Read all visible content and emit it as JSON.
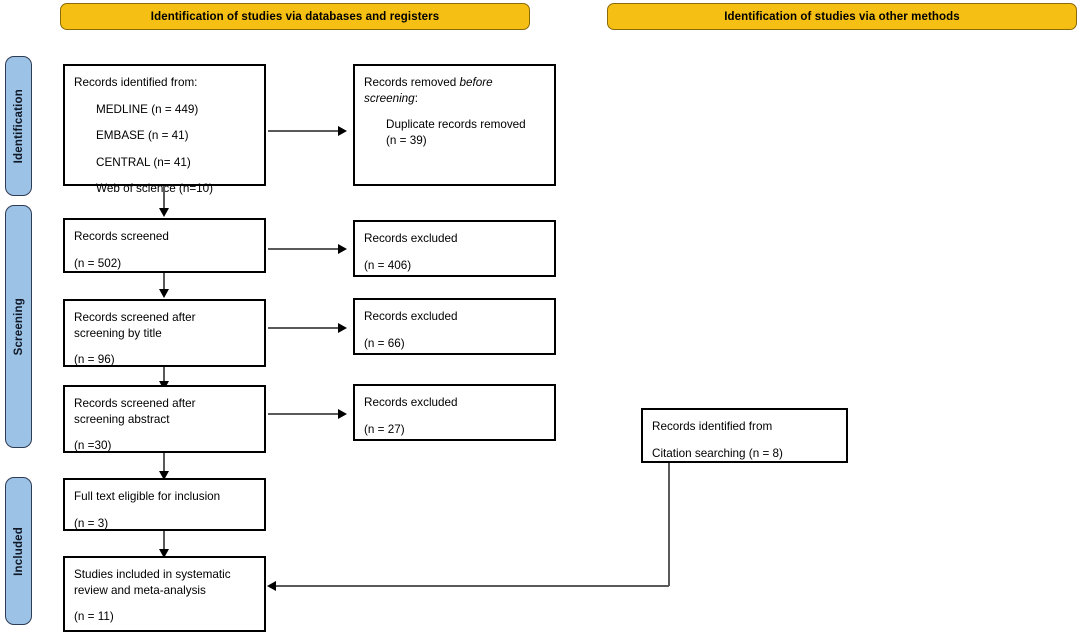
{
  "banners": [
    {
      "id": "databases-registers",
      "label": "Identification of studies via databases and registers"
    },
    {
      "id": "other-methods",
      "label": "Identification of studies via other methods"
    }
  ],
  "stages": [
    {
      "id": "identification",
      "label": "Identification"
    },
    {
      "id": "screening",
      "label": "Screening"
    },
    {
      "id": "included",
      "label": "Included"
    }
  ],
  "nodes": {
    "records_identified": {
      "title": "Records identified from:",
      "sources": [
        "MEDLINE (n = 449)",
        "EMBASE (n = 41)",
        "CENTRAL (n= 41)",
        "Web of science (n=10)"
      ]
    },
    "records_removed": {
      "line1_prefix": "Records removed ",
      "line1_italic": "before",
      "line2_italic": "screening",
      "line2_suffix": ":",
      "detail_line1": "Duplicate records removed",
      "detail_line2": "(n = 39)"
    },
    "records_screened": {
      "title": "Records screened",
      "count": "(n = 502)"
    },
    "excluded_1": {
      "title": "Records excluded",
      "count": "(n = 406)"
    },
    "screened_title": {
      "title_line1": "Records screened after",
      "title_line2": "screening by title",
      "count": "(n = 96)"
    },
    "excluded_2": {
      "title": "Records excluded",
      "count": "(n = 66)"
    },
    "screened_abstract": {
      "title_line1": "Records screened after",
      "title_line2": "screening abstract",
      "count": "(n =30)"
    },
    "excluded_3": {
      "title": "Records excluded",
      "count": "(n = 27)"
    },
    "full_text": {
      "title": "Full text eligible for inclusion",
      "count": "(n = 3)"
    },
    "studies_included": {
      "title_line1": "Studies included in systematic",
      "title_line2": "review and meta-analysis",
      "count": "(n = 11)"
    },
    "citation_searching": {
      "title": "Records identified from",
      "detail": "Citation searching (n = 8)"
    }
  },
  "colors": {
    "banner_fill": "#F5BF14",
    "banner_border": "#8A6A08",
    "stage_fill": "#9CC3E5",
    "stage_border": "#2D3B55",
    "node_border": "#000000",
    "connector": "#595959",
    "background": "#FFFFFF"
  }
}
